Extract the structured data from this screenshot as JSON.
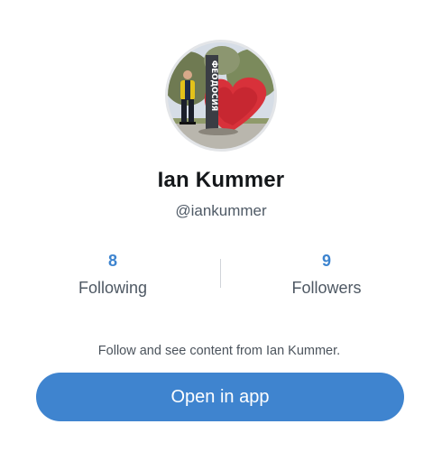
{
  "profile": {
    "name": "Ian Kummer",
    "handle": "@iankummer",
    "avatar_sign_text": "ФЕОДОСИЯ"
  },
  "stats": {
    "following": {
      "value": "8",
      "label": "Following"
    },
    "followers": {
      "value": "9",
      "label": "Followers"
    }
  },
  "cta": {
    "prompt": "Follow and see content from Ian Kummer.",
    "button_label": "Open in app"
  },
  "colors": {
    "accent": "#3f84cf",
    "name_text": "#14171a",
    "secondary_text": "#4e5863"
  }
}
